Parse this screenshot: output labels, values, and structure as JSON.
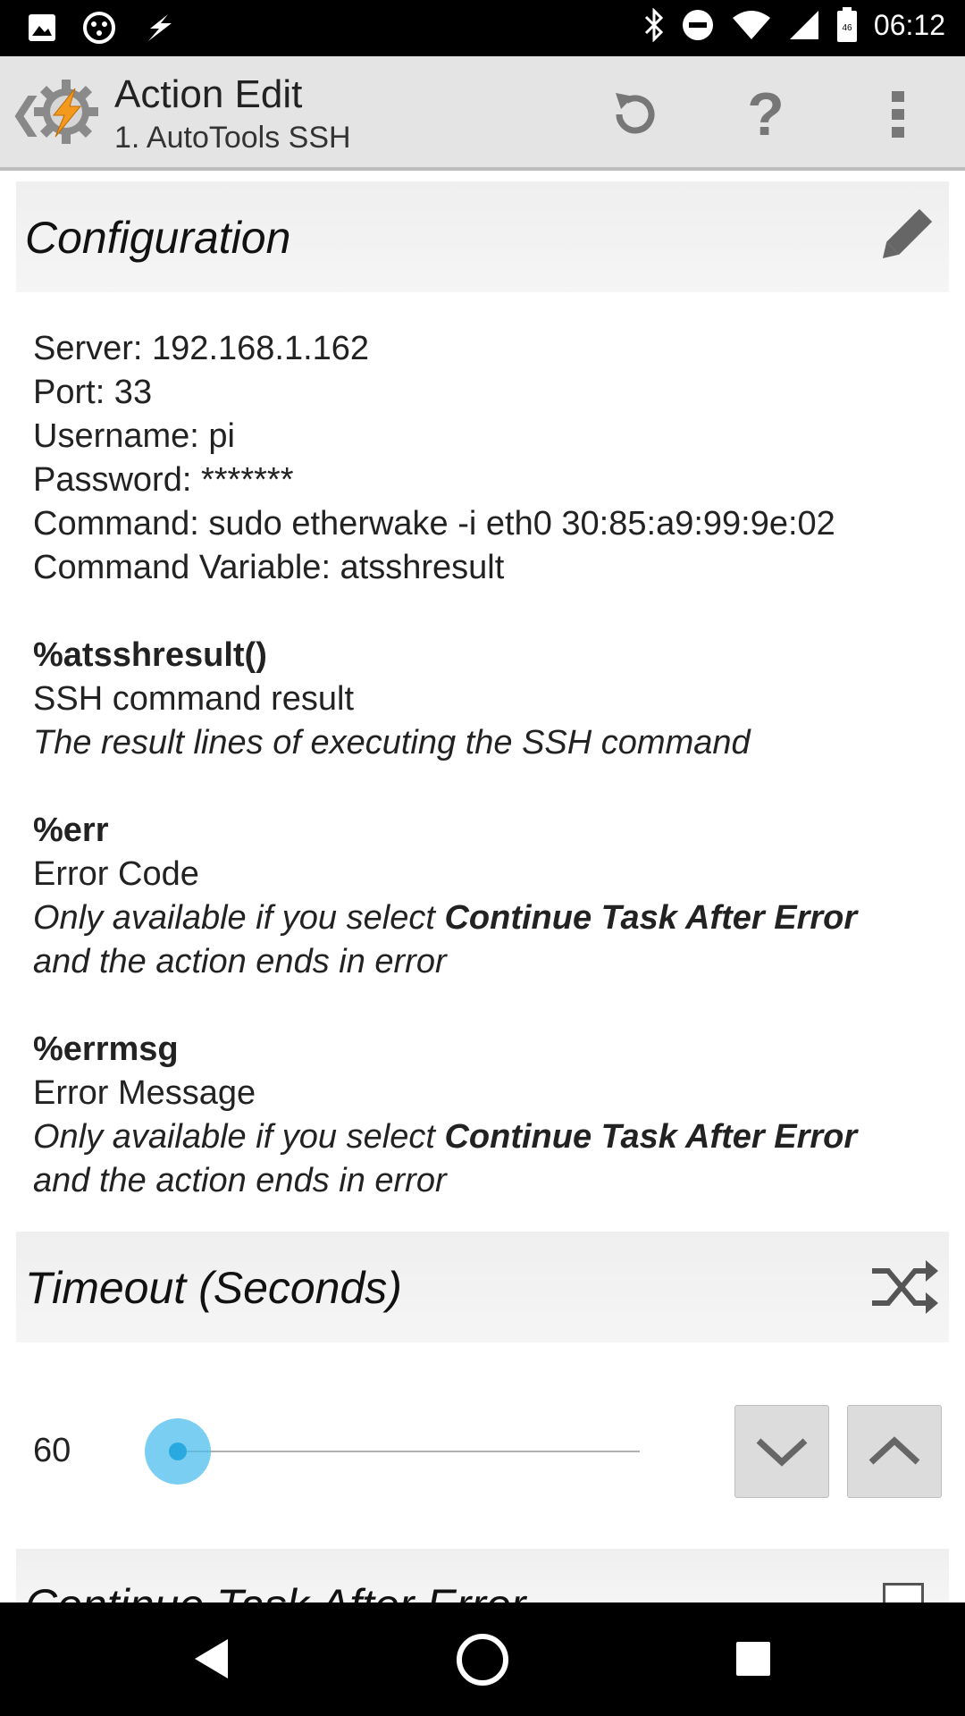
{
  "status_bar": {
    "time": "06:12",
    "battery_label": "46",
    "icons": [
      "image-icon",
      "app-icon",
      "tasker-icon",
      "bluetooth-icon",
      "dnd-icon",
      "wifi-icon",
      "signal-icon",
      "battery-icon"
    ]
  },
  "action_bar": {
    "title": "Action Edit",
    "subtitle": "1. AutoTools SSH",
    "back_glyph": "❮",
    "help_label": "?"
  },
  "configuration": {
    "header": "Configuration",
    "lines": {
      "server": "Server: 192.168.1.162",
      "port": "Port: 33",
      "username": "Username: pi",
      "password": "Password: *******",
      "command": "Command: sudo etherwake -i eth0 30:85:a9:99:9e:02",
      "command_variable": "Command Variable: atsshresult"
    },
    "variables": [
      {
        "name": "%atsshresult()",
        "label": "SSH command result",
        "desc_plain": "The result lines of executing the SSH command",
        "desc_bold": "",
        "desc_tail": ""
      },
      {
        "name": "%err",
        "label": "Error Code",
        "desc_plain": "Only available if you select ",
        "desc_bold": "Continue Task After Error",
        "desc_tail": "and the action ends in error"
      },
      {
        "name": "%errmsg",
        "label": "Error Message",
        "desc_plain": "Only available if you select ",
        "desc_bold": "Continue Task After Error",
        "desc_tail": "and the action ends in error"
      }
    ]
  },
  "timeout": {
    "header": "Timeout (Seconds)",
    "value": "60",
    "slider_fraction": 0.0
  },
  "next_section": {
    "header": "Continue Task After Error",
    "checked": false
  },
  "colors": {
    "accent": "#29a9e0",
    "header_bg": "#efefef",
    "action_bar_bg": "#e4e4e4"
  }
}
